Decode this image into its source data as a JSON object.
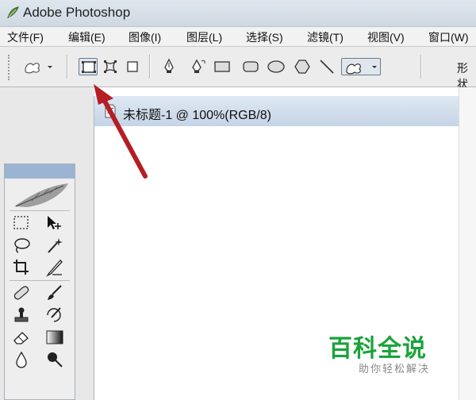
{
  "window": {
    "title": "Adobe Photoshop"
  },
  "menu": [
    {
      "label": "文件(F)"
    },
    {
      "label": "编辑(E)"
    },
    {
      "label": "图像(I)"
    },
    {
      "label": "图层(L)"
    },
    {
      "label": "选择(S)"
    },
    {
      "label": "滤镜(T)"
    },
    {
      "label": "视图(V)"
    },
    {
      "label": "窗口(W)"
    }
  ],
  "options_bar": {
    "shape_mode_label": "形状",
    "selected_tool": "shape-layers"
  },
  "document": {
    "title": "未标题-1 @ 100%(RGB/8)"
  },
  "watermark": {
    "main": "百科全说",
    "sub": "助你轻松解决"
  },
  "colors": {
    "annotation_arrow": "#b51e24",
    "watermark_green": "#1aa33a",
    "doc_titlebar": "#c5d4e6"
  }
}
